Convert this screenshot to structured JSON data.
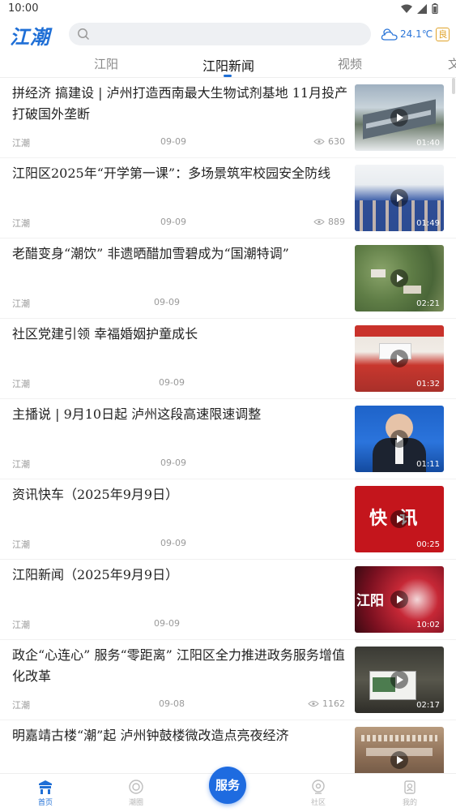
{
  "status_bar": {
    "time": "10:00"
  },
  "header": {
    "logo": "江潮",
    "weather": {
      "temperature": "24.1℃",
      "aqi": "良"
    }
  },
  "tabs": [
    {
      "label": "江阳"
    },
    {
      "label": "江阳新闻"
    },
    {
      "label": "视频"
    },
    {
      "label": "文"
    }
  ],
  "news": [
    {
      "title": "拼经济 搞建设 | 泸州打造西南最大生物试剂基地 11月投产打破国外垄断",
      "source": "江潮",
      "date": "09-09",
      "views": "630",
      "duration": "01:40"
    },
    {
      "title": "江阳区2025年“开学第一课”：多场景筑牢校园安全防线",
      "source": "江潮",
      "date": "09-09",
      "views": "889",
      "duration": "01:49"
    },
    {
      "title": "老醋变身“潮饮” 非遗晒醋加雪碧成为“国潮特调”",
      "source": "江潮",
      "date": "09-09",
      "views": "",
      "duration": "02:21"
    },
    {
      "title": "社区党建引领 幸福婚姻护童成长",
      "source": "江潮",
      "date": "09-09",
      "views": "",
      "duration": "01:32"
    },
    {
      "title": "主播说 | 9月10日起 泸州这段高速限速调整",
      "source": "江潮",
      "date": "09-09",
      "views": "",
      "duration": "01:11"
    },
    {
      "title": "资讯快车（2025年9月9日）",
      "source": "江潮",
      "date": "09-09",
      "views": "",
      "duration": "00:25",
      "thumb_text": "快  讯"
    },
    {
      "title": "江阳新闻（2025年9月9日）",
      "source": "江潮",
      "date": "09-09",
      "views": "",
      "duration": "10:02",
      "thumb_text": "江阳"
    },
    {
      "title": "政企“心连心” 服务“零距离” 江阳区全力推进政务服务增值化改革",
      "source": "江潮",
      "date": "09-08",
      "views": "1162",
      "duration": "02:17"
    },
    {
      "title": "明嘉靖古楼“潮”起 泸州钟鼓楼微改造点亮夜经济",
      "source": "",
      "date": "",
      "views": "",
      "duration": ""
    }
  ],
  "bottom_nav": {
    "items": [
      {
        "label": "首页",
        "icon": "home-icon"
      },
      {
        "label": "潮圈",
        "icon": "circle-icon"
      },
      {
        "label": "社区",
        "icon": "community-icon"
      },
      {
        "label": "我的",
        "icon": "profile-icon"
      }
    ],
    "service_label": "服务"
  },
  "colors": {
    "accent": "#1f6fd6",
    "aqi": "#e0a32a"
  }
}
